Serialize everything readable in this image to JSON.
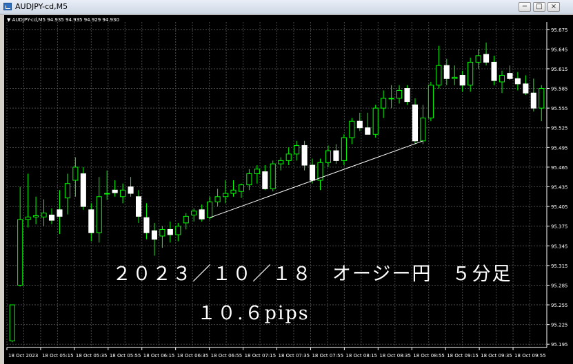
{
  "window": {
    "title": "AUDJPY-cd,M5",
    "buttons": {
      "minimize": "−",
      "maximize": "□",
      "close": "×"
    }
  },
  "header": {
    "symbol_label": "AUDJPY-cd,M5",
    "ohlc_text": "94.935 94.935 94.929 94.930"
  },
  "overlay": {
    "title": "２０２３／１０／１８　オージー円　５分足",
    "pips": "１０.６pips"
  },
  "colors": {
    "background": "#000000",
    "bull_fill": "#000000",
    "bull_border": "#00ff00",
    "bear_fill": "#ffffff",
    "wick": "#00ff00",
    "grid": "#4a4a4a",
    "trendline": "#ffffff",
    "axis_text": "#ffffff"
  },
  "chart_data": {
    "type": "candlestick",
    "symbol": "AUDJPY-cd",
    "timeframe": "M5",
    "y_ticks": [
      "95.675",
      "95.645",
      "95.615",
      "95.585",
      "95.555",
      "95.525",
      "95.495",
      "95.465",
      "95.435",
      "95.405",
      "95.375",
      "95.345",
      "95.315",
      "95.285",
      "95.255",
      "95.225",
      "95.195"
    ],
    "ylim": [
      95.19,
      95.68
    ],
    "x_ticks": [
      "18 Oct 2023",
      "18 Oct 05:15",
      "18 Oct 05:35",
      "18 Oct 05:55",
      "18 Oct 06:15",
      "18 Oct 06:35",
      "18 Oct 06:55",
      "18 Oct 07:15",
      "18 Oct 07:35",
      "18 Oct 07:55",
      "18 Oct 08:15",
      "18 Oct 08:35",
      "18 Oct 08:55",
      "18 Oct 09:15",
      "18 Oct 09:35",
      "18 Oct 09:55"
    ],
    "candles": [
      {
        "o": 95.2,
        "h": 95.255,
        "l": 95.198,
        "c": 95.255
      },
      {
        "o": 95.285,
        "h": 95.435,
        "l": 95.283,
        "c": 95.385
      },
      {
        "o": 95.385,
        "h": 95.455,
        "l": 95.373,
        "c": 95.389
      },
      {
        "o": 95.389,
        "h": 95.42,
        "l": 95.378,
        "c": 95.391
      },
      {
        "o": 95.389,
        "h": 95.416,
        "l": 95.375,
        "c": 95.395
      },
      {
        "o": 95.392,
        "h": 95.402,
        "l": 95.378,
        "c": 95.384
      },
      {
        "o": 95.4,
        "h": 95.43,
        "l": 95.363,
        "c": 95.39
      },
      {
        "o": 95.418,
        "h": 95.455,
        "l": 95.393,
        "c": 95.44
      },
      {
        "o": 95.445,
        "h": 95.48,
        "l": 95.42,
        "c": 95.465
      },
      {
        "o": 95.455,
        "h": 95.465,
        "l": 95.4,
        "c": 95.405
      },
      {
        "o": 95.4,
        "h": 95.41,
        "l": 95.352,
        "c": 95.365
      },
      {
        "o": 95.365,
        "h": 95.45,
        "l": 95.35,
        "c": 95.42
      },
      {
        "o": 95.425,
        "h": 95.46,
        "l": 95.415,
        "c": 95.425
      },
      {
        "o": 95.43,
        "h": 95.445,
        "l": 95.42,
        "c": 95.426
      },
      {
        "o": 95.42,
        "h": 95.44,
        "l": 95.41,
        "c": 95.43
      },
      {
        "o": 95.435,
        "h": 95.45,
        "l": 95.42,
        "c": 95.425
      },
      {
        "o": 95.42,
        "h": 95.43,
        "l": 95.38,
        "c": 95.39
      },
      {
        "o": 95.388,
        "h": 95.41,
        "l": 95.355,
        "c": 95.365
      },
      {
        "o": 95.368,
        "h": 95.38,
        "l": 95.33,
        "c": 95.355
      },
      {
        "o": 95.36,
        "h": 95.375,
        "l": 95.342,
        "c": 95.37
      },
      {
        "o": 95.37,
        "h": 95.382,
        "l": 95.35,
        "c": 95.362
      },
      {
        "o": 95.362,
        "h": 95.38,
        "l": 95.352,
        "c": 95.375
      },
      {
        "o": 95.38,
        "h": 95.395,
        "l": 95.37,
        "c": 95.39
      },
      {
        "o": 95.392,
        "h": 95.402,
        "l": 95.382,
        "c": 95.398
      },
      {
        "o": 95.4,
        "h": 95.408,
        "l": 95.382,
        "c": 95.386
      },
      {
        "o": 95.388,
        "h": 95.42,
        "l": 95.385,
        "c": 95.412
      },
      {
        "o": 95.412,
        "h": 95.432,
        "l": 95.405,
        "c": 95.42
      },
      {
        "o": 95.42,
        "h": 95.445,
        "l": 95.41,
        "c": 95.425
      },
      {
        "o": 95.425,
        "h": 95.445,
        "l": 95.42,
        "c": 95.43
      },
      {
        "o": 95.428,
        "h": 95.44,
        "l": 95.418,
        "c": 95.438
      },
      {
        "o": 95.438,
        "h": 95.462,
        "l": 95.43,
        "c": 95.455
      },
      {
        "o": 95.455,
        "h": 95.468,
        "l": 95.44,
        "c": 95.462
      },
      {
        "o": 95.458,
        "h": 95.468,
        "l": 95.43,
        "c": 95.432
      },
      {
        "o": 95.432,
        "h": 95.475,
        "l": 95.428,
        "c": 95.47
      },
      {
        "o": 95.47,
        "h": 95.48,
        "l": 95.46,
        "c": 95.475
      },
      {
        "o": 95.475,
        "h": 95.495,
        "l": 95.468,
        "c": 95.485
      },
      {
        "o": 95.485,
        "h": 95.505,
        "l": 95.475,
        "c": 95.498
      },
      {
        "o": 95.498,
        "h": 95.505,
        "l": 95.46,
        "c": 95.468
      },
      {
        "o": 95.468,
        "h": 95.478,
        "l": 95.44,
        "c": 95.445
      },
      {
        "o": 95.445,
        "h": 95.478,
        "l": 95.43,
        "c": 95.472
      },
      {
        "o": 95.472,
        "h": 95.498,
        "l": 95.465,
        "c": 95.49
      },
      {
        "o": 95.49,
        "h": 95.5,
        "l": 95.47,
        "c": 95.475
      },
      {
        "o": 95.475,
        "h": 95.515,
        "l": 95.468,
        "c": 95.51
      },
      {
        "o": 95.51,
        "h": 95.54,
        "l": 95.5,
        "c": 95.535
      },
      {
        "o": 95.535,
        "h": 95.548,
        "l": 95.52,
        "c": 95.525
      },
      {
        "o": 95.525,
        "h": 95.548,
        "l": 95.515,
        "c": 95.515
      },
      {
        "o": 95.515,
        "h": 95.56,
        "l": 95.51,
        "c": 95.555
      },
      {
        "o": 95.555,
        "h": 95.582,
        "l": 95.54,
        "c": 95.57
      },
      {
        "o": 95.57,
        "h": 95.59,
        "l": 95.555,
        "c": 95.57
      },
      {
        "o": 95.57,
        "h": 95.59,
        "l": 95.562,
        "c": 95.582
      },
      {
        "o": 95.585,
        "h": 95.59,
        "l": 95.56,
        "c": 95.565
      },
      {
        "o": 95.56,
        "h": 95.57,
        "l": 95.5,
        "c": 95.505
      },
      {
        "o": 95.505,
        "h": 95.56,
        "l": 95.5,
        "c": 95.54
      },
      {
        "o": 95.54,
        "h": 95.595,
        "l": 95.535,
        "c": 95.59
      },
      {
        "o": 95.59,
        "h": 95.65,
        "l": 95.585,
        "c": 95.62
      },
      {
        "o": 95.62,
        "h": 95.63,
        "l": 95.59,
        "c": 95.6
      },
      {
        "o": 95.6,
        "h": 95.62,
        "l": 95.59,
        "c": 95.602
      },
      {
        "o": 95.605,
        "h": 95.612,
        "l": 95.58,
        "c": 95.59
      },
      {
        "o": 95.59,
        "h": 95.632,
        "l": 95.58,
        "c": 95.625
      },
      {
        "o": 95.625,
        "h": 95.645,
        "l": 95.615,
        "c": 95.635
      },
      {
        "o": 95.637,
        "h": 95.655,
        "l": 95.62,
        "c": 95.625
      },
      {
        "o": 95.625,
        "h": 95.635,
        "l": 95.59,
        "c": 95.597
      },
      {
        "o": 95.595,
        "h": 95.612,
        "l": 95.578,
        "c": 95.605
      },
      {
        "o": 95.608,
        "h": 95.62,
        "l": 95.598,
        "c": 95.6
      },
      {
        "o": 95.6,
        "h": 95.61,
        "l": 95.582,
        "c": 95.592
      },
      {
        "o": 95.592,
        "h": 95.605,
        "l": 95.575,
        "c": 95.578
      },
      {
        "o": 95.578,
        "h": 95.6,
        "l": 95.55,
        "c": 95.555
      },
      {
        "o": 95.555,
        "h": 95.59,
        "l": 95.535,
        "c": 95.585
      }
    ]
  }
}
